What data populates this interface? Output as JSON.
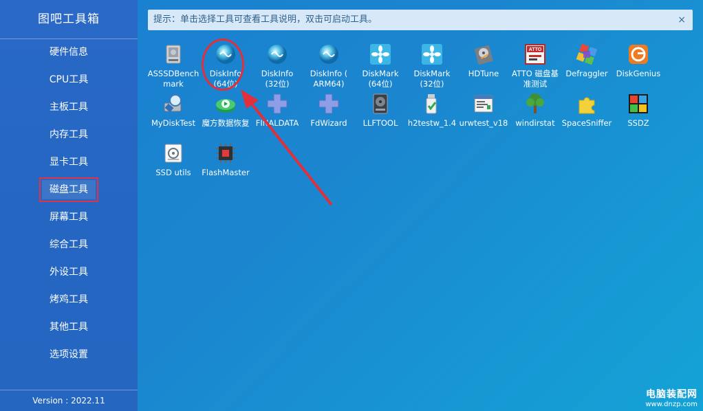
{
  "app": {
    "title": "图吧工具箱",
    "version": "Version : 2022.11"
  },
  "sidebar": {
    "items": [
      {
        "label": "硬件信息"
      },
      {
        "label": "CPU工具"
      },
      {
        "label": "主板工具"
      },
      {
        "label": "内存工具"
      },
      {
        "label": "显卡工具"
      },
      {
        "label": "磁盘工具",
        "active": true
      },
      {
        "label": "屏幕工具"
      },
      {
        "label": "综合工具"
      },
      {
        "label": "外设工具"
      },
      {
        "label": "烤鸡工具"
      },
      {
        "label": "其他工具"
      },
      {
        "label": "选项设置"
      }
    ]
  },
  "hint": {
    "text": "提示：单击选择工具可查看工具说明，双击可启动工具。",
    "close": "×"
  },
  "tools": [
    {
      "label": "ASSSDBench\nmark",
      "icon": "hdd-icon"
    },
    {
      "label": "DiskInfo\n(64位)",
      "icon": "diskinfo-icon"
    },
    {
      "label": "DiskInfo\n(32位)",
      "icon": "diskinfo-icon"
    },
    {
      "label": "DiskInfo (\nARM64)",
      "icon": "diskinfo-icon"
    },
    {
      "label": "DiskMark\n(64位)",
      "icon": "diskmark-icon"
    },
    {
      "label": "DiskMark\n(32位)",
      "icon": "diskmark-icon"
    },
    {
      "label": "HDTune",
      "icon": "hdtune-icon"
    },
    {
      "label": "ATTO 磁盘基\n准测试",
      "icon": "atto-icon"
    },
    {
      "label": "Defraggler",
      "icon": "defraggler-icon"
    },
    {
      "label": "DiskGenius",
      "icon": "diskgenius-icon"
    },
    {
      "label": "MyDiskTest",
      "icon": "mydisktest-icon"
    },
    {
      "label": "魔方数据恢复",
      "icon": "recovery-icon"
    },
    {
      "label": "FINALDATA",
      "icon": "puzzle-cross-icon"
    },
    {
      "label": "FdWizard",
      "icon": "puzzle-cross-icon"
    },
    {
      "label": "LLFTOOL",
      "icon": "llftool-icon"
    },
    {
      "label": "h2testw_1.4",
      "icon": "usb-check-icon"
    },
    {
      "label": "urwtest_v18",
      "icon": "window-icon"
    },
    {
      "label": "windirstat",
      "icon": "tree-icon"
    },
    {
      "label": "SpaceSniffer",
      "icon": "puzzle-icon"
    },
    {
      "label": "SSDZ",
      "icon": "ssdz-icon"
    },
    {
      "label": "SSD utils",
      "icon": "ssd-utils-icon"
    },
    {
      "label": "FlashMaster",
      "icon": "chip-icon"
    }
  ],
  "watermark": {
    "cn": "电脑装配网",
    "url": "www.dnzp.com"
  },
  "colors": {
    "highlight": "#e0303b",
    "sidebar": "#2566c0",
    "hint_bg": "#e1eefa"
  }
}
